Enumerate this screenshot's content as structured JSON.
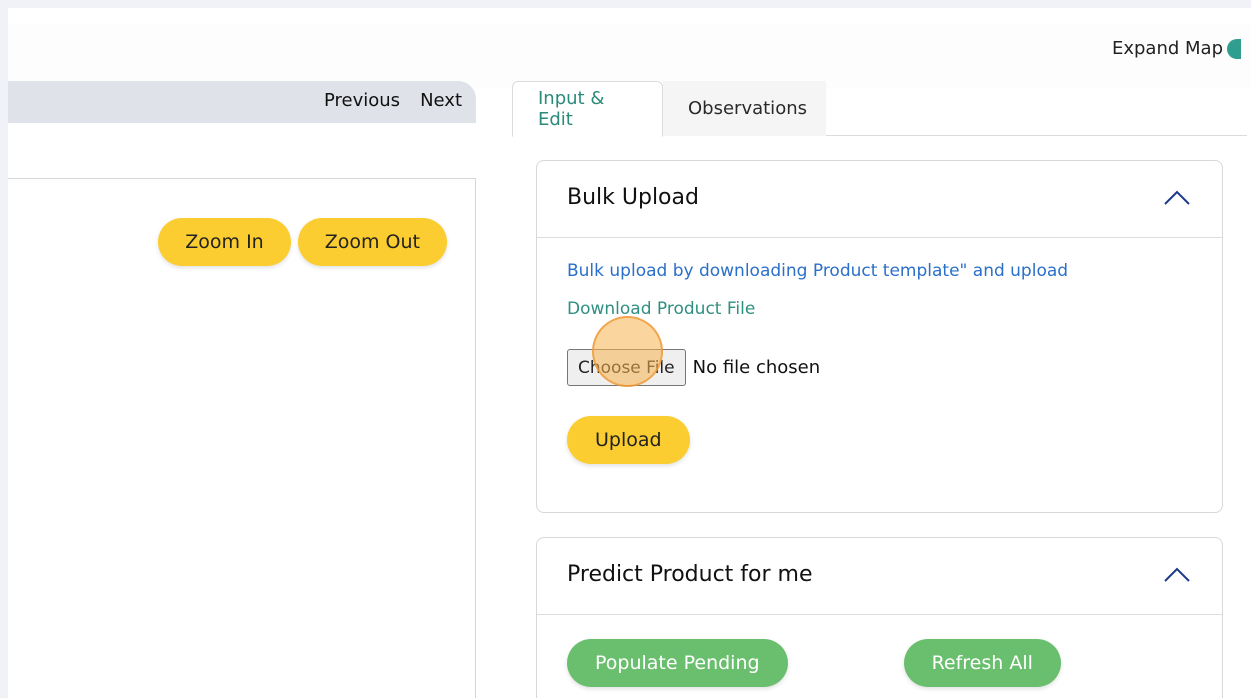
{
  "header": {
    "expand_map_label": "Expand Map"
  },
  "left_pane": {
    "nav": {
      "previous_label": "Previous",
      "next_label": "Next"
    },
    "zoom": {
      "zoom_in_label": "Zoom In",
      "zoom_out_label": "Zoom Out"
    }
  },
  "tabs": [
    {
      "label": "Input & Edit",
      "active": true
    },
    {
      "label": "Observations",
      "active": false
    }
  ],
  "bulk_upload": {
    "title": "Bulk Upload",
    "info_text": "Bulk upload by downloading Product template\" and upload",
    "download_link": "Download Product File",
    "choose_file_label": "Choose File",
    "file_status": "No file chosen",
    "upload_label": "Upload"
  },
  "predict": {
    "title": "Predict Product for me",
    "populate_label": "Populate Pending",
    "refresh_label": "Refresh All"
  },
  "colors": {
    "accent_teal": "#2c8a7a",
    "button_yellow": "#fbcd30",
    "button_green": "#6abf6e",
    "link_blue": "#2a6fc9"
  }
}
